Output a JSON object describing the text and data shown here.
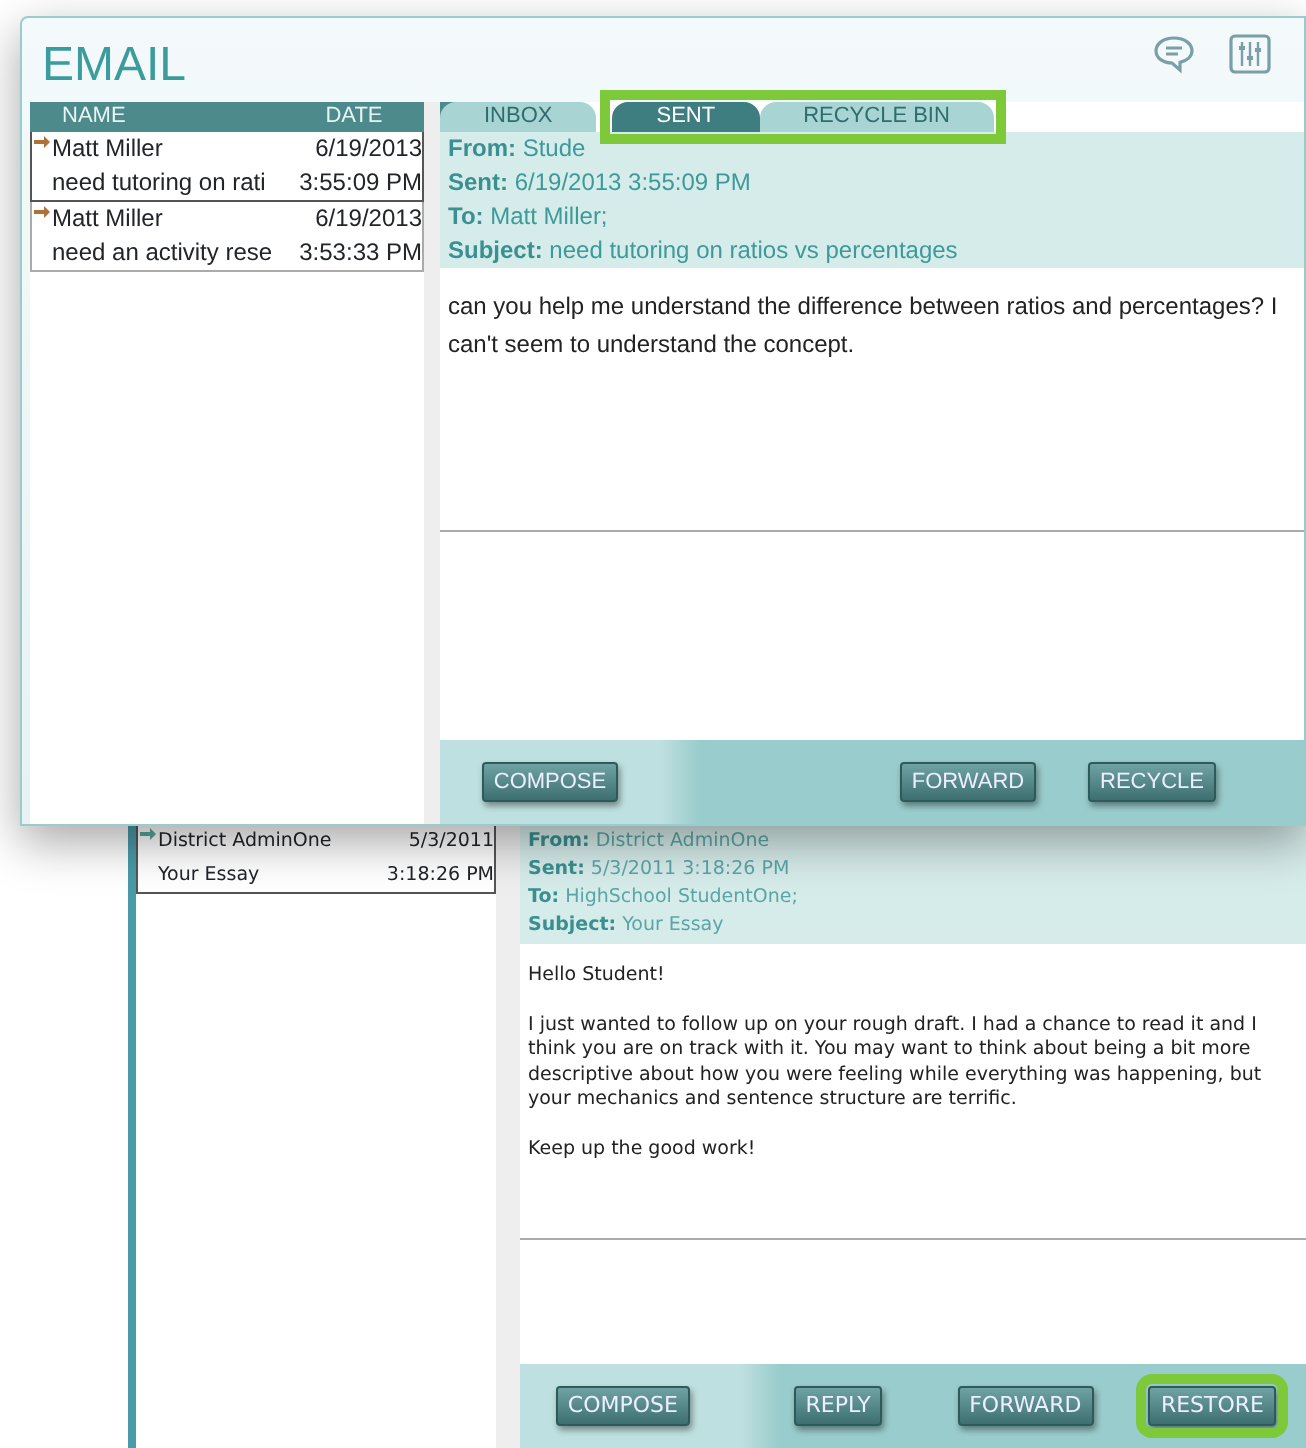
{
  "front_window": {
    "title": "EMAIL",
    "list_columns": [
      "NAME",
      "DATE"
    ],
    "messages": [
      {
        "name": "Matt Miller",
        "subject": "need tutoring on rati",
        "date": "6/19/2013",
        "time": "3:55:09 PM",
        "selected": true
      },
      {
        "name": "Matt Miller",
        "subject": "need an activity resе",
        "date": "6/19/2013",
        "time": "3:53:33 PM",
        "selected": false
      }
    ],
    "tabs": [
      {
        "label": "INBOX",
        "selected": false
      },
      {
        "label": "SENT",
        "selected": true
      },
      {
        "label": "RECYCLE BIN",
        "selected": false
      }
    ],
    "tabs_highlighted": true,
    "header": [
      "**From:** Stude",
      "**Sent:** 6/19/2013 3:55:09 PM",
      "**To:** Matt Miller;",
      "**Subject:** need tutoring on ratios vs percentages"
    ],
    "body": [
      "can you help me understand the difference between ratios and percentages? I can't seem to understand the concept."
    ],
    "buttons": [
      {
        "label": "COMPOSE",
        "highlighted": false
      },
      {
        "label": "FORWARD",
        "highlighted": false
      },
      {
        "label": "RECYCLE",
        "highlighted": false
      }
    ]
  },
  "back_window": {
    "messages": [
      {
        "name": "District AdminOne",
        "subject": "Your Essay",
        "date": "5/3/2011",
        "time": "3:18:26 PM",
        "selected": true
      }
    ],
    "header": [
      "**From:** District AdminOne",
      "**Sent:** 5/3/2011 3:18:26 PM",
      "**To:** HighSchool StudentOne;",
      "**Subject:** Your Essay"
    ],
    "body": [
      "Hello Student!",
      "I just wanted to follow up on your rough draft. I had a chance to read it and I think you are on track with it. You may want to think about being a bit more descriptive about how you were feeling while everything was happening, but your mechanics and sentence structure are terrific.",
      "Keep up the good work!"
    ],
    "buttons": [
      {
        "label": "COMPOSE",
        "highlighted": false
      },
      {
        "label": "REPLY",
        "highlighted": false
      },
      {
        "label": "FORWARD",
        "highlighted": false
      },
      {
        "label": "RESTORE",
        "highlighted": true
      }
    ]
  }
}
